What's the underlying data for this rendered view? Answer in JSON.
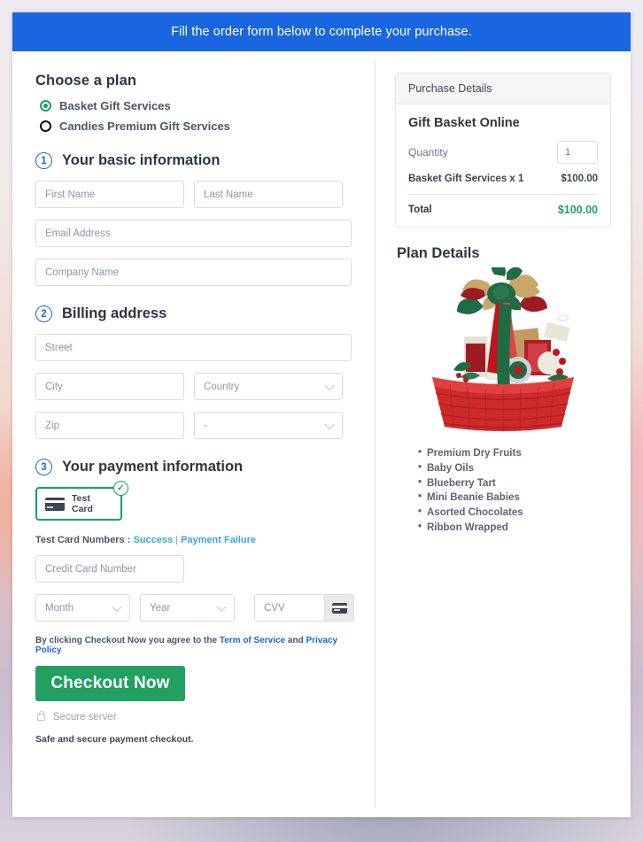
{
  "banner": {
    "text": "Fill the order form below to complete your purchase."
  },
  "plan": {
    "heading": "Choose a plan",
    "options": [
      {
        "label": "Basket Gift Services",
        "selected": true
      },
      {
        "label": "Candies Premium Gift Services",
        "selected": false
      }
    ]
  },
  "steps": {
    "basic": {
      "num": "1",
      "title": "Your basic information"
    },
    "billing": {
      "num": "2",
      "title": "Billing address"
    },
    "payment": {
      "num": "3",
      "title": "Your payment information"
    }
  },
  "basic_fields": {
    "first_name": {
      "placeholder": "First Name",
      "value": ""
    },
    "last_name": {
      "placeholder": "Last Name",
      "value": ""
    },
    "email": {
      "placeholder": "Email Address",
      "value": ""
    },
    "company": {
      "placeholder": "Company Name",
      "value": ""
    }
  },
  "billing_fields": {
    "street": {
      "placeholder": "Street",
      "value": ""
    },
    "city": {
      "placeholder": "City",
      "value": ""
    },
    "country": {
      "placeholder": "Country",
      "value": ""
    },
    "zip": {
      "placeholder": "Zip",
      "value": ""
    },
    "state": {
      "placeholder": "-",
      "value": ""
    }
  },
  "payment": {
    "card_option_label": "Test  Card",
    "card_option_selected": true,
    "check_glyph": "✓",
    "test_numbers_prefix": "Test Card Numbers : ",
    "link_success": "Success",
    "link_separator": " | ",
    "link_failure": "Payment Failure",
    "card_number": {
      "placeholder": "Credit Card Number",
      "value": ""
    },
    "month": {
      "placeholder": "Month",
      "value": ""
    },
    "year": {
      "placeholder": "Year",
      "value": ""
    },
    "cvv": {
      "placeholder": "CVV",
      "value": ""
    }
  },
  "footer": {
    "terms_prefix": "By clicking Checkout Now you agree to the ",
    "terms_link": "Term of Service",
    "terms_middle": " and ",
    "privacy_link": "Privacy Policy",
    "checkout_label": "Checkout Now",
    "secure_server": "Secure server",
    "safe_text": "Safe and secure payment checkout."
  },
  "purchase": {
    "head": "Purchase Details",
    "product_title": "Gift Basket Online",
    "quantity_label": "Quantity",
    "quantity_value": "1",
    "line_label": "Basket Gift Services x 1",
    "line_value": "$100.00",
    "total_label": "Total",
    "total_value": "$100.00"
  },
  "plan_details": {
    "title": "Plan Details",
    "features": [
      "Premium Dry Fruits",
      "Baby Oils",
      "Blueberry Tart",
      "Mini Beanie Babies",
      "Asorted Chocolates",
      "Ribbon Wrapped"
    ]
  },
  "colors": {
    "banner_blue": "#1a66e0",
    "accent_green": "#22a060",
    "card_border_green": "#17a263",
    "link_blue": "#1a66e0",
    "link_cyan": "#3aa7d4",
    "radio_green": "#1aa06d"
  }
}
